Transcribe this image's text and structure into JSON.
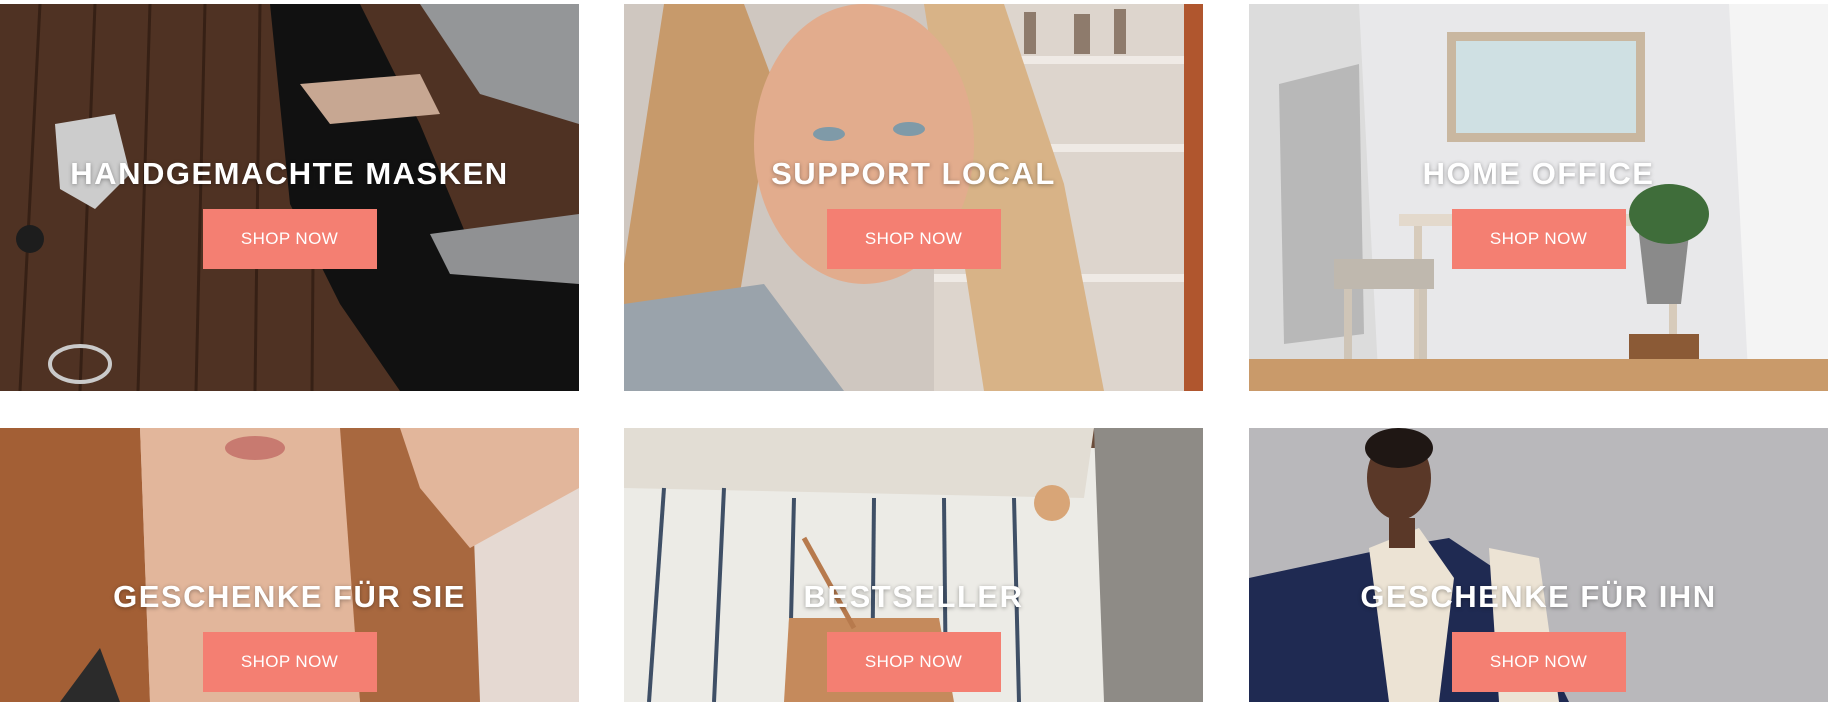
{
  "tiles": [
    {
      "title": "HANDGEMACHTE MASKEN",
      "button": "SHOP NOW"
    },
    {
      "title": "SUPPORT LOCAL",
      "button": "SHOP NOW"
    },
    {
      "title": "HOME OFFICE",
      "button": "SHOP NOW"
    },
    {
      "title": "GESCHENKE FÜR SIE",
      "button": "SHOP NOW"
    },
    {
      "title": "BESTSELLER",
      "button": "SHOP NOW"
    },
    {
      "title": "GESCHENKE FÜR IHN",
      "button": "SHOP NOW"
    }
  ],
  "colors": {
    "accent": "#f47f72",
    "title_text": "#ffffff"
  }
}
